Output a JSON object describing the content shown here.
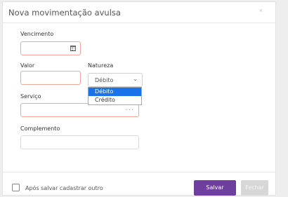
{
  "modal": {
    "title": "Nova movimentação avulsa",
    "close_glyph": "×"
  },
  "form": {
    "vencimento": {
      "label": "Vencimento",
      "value": "",
      "icon": "calendar-icon"
    },
    "valor": {
      "label": "Valor",
      "value": ""
    },
    "natureza": {
      "label": "Natureza",
      "selected": "Débito",
      "options": [
        "Débito",
        "Crédito"
      ],
      "chevron": "⌄"
    },
    "servico": {
      "label": "Serviço",
      "value": "",
      "lookup_glyph": "···"
    },
    "complemento": {
      "label": "Complemento",
      "value": ""
    }
  },
  "footer": {
    "checkbox_label": "Após salvar cadastrar outro",
    "save_label": "Salvar",
    "close_label": "Fechar"
  },
  "colors": {
    "primary": "#6f3f9f",
    "error_border": "#f0a89a",
    "dropdown_selected": "#1a73e8"
  }
}
